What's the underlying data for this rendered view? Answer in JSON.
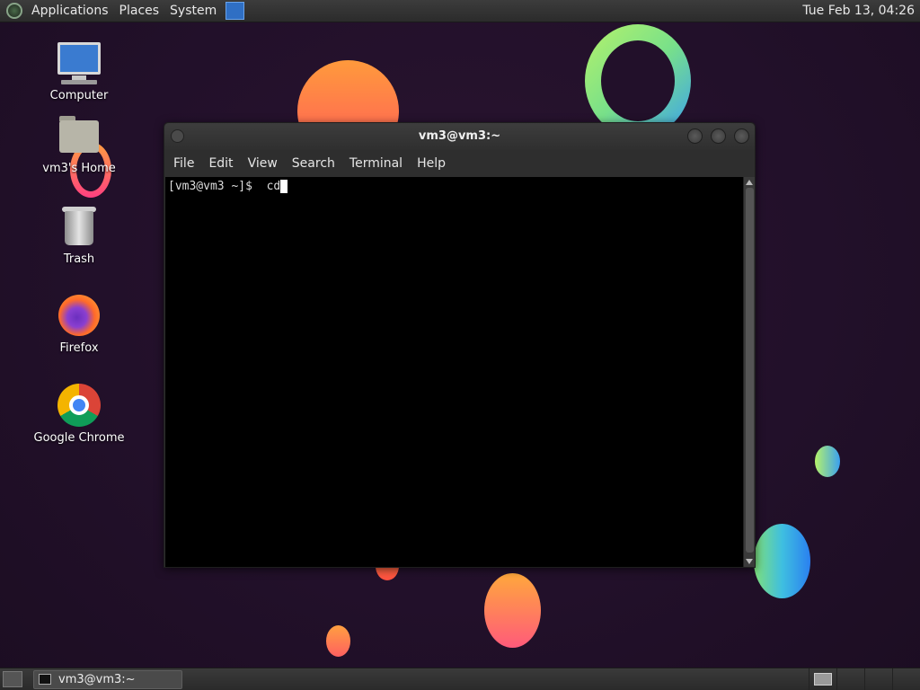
{
  "top_panel": {
    "menus": [
      "Applications",
      "Places",
      "System"
    ],
    "clock": "Tue Feb 13, 04:26"
  },
  "desktop": {
    "icons": [
      {
        "label": "Computer",
        "icon": "computer-icon"
      },
      {
        "label": "vm3's Home",
        "icon": "home-folder-icon"
      },
      {
        "label": "Trash",
        "icon": "trash-icon"
      },
      {
        "label": "Firefox",
        "icon": "firefox-icon"
      },
      {
        "label": "Google Chrome",
        "icon": "chrome-icon"
      }
    ]
  },
  "terminal": {
    "title": "vm3@vm3:~",
    "menu": [
      "File",
      "Edit",
      "View",
      "Search",
      "Terminal",
      "Help"
    ],
    "prompt": "[vm3@vm3 ~]$",
    "command": "cd"
  },
  "taskbar": {
    "window_label": "vm3@vm3:~"
  },
  "colors": {
    "desktop_bg": "#22102a",
    "panel_bg": "#2b2b2b",
    "terminal_bg": "#000000"
  }
}
